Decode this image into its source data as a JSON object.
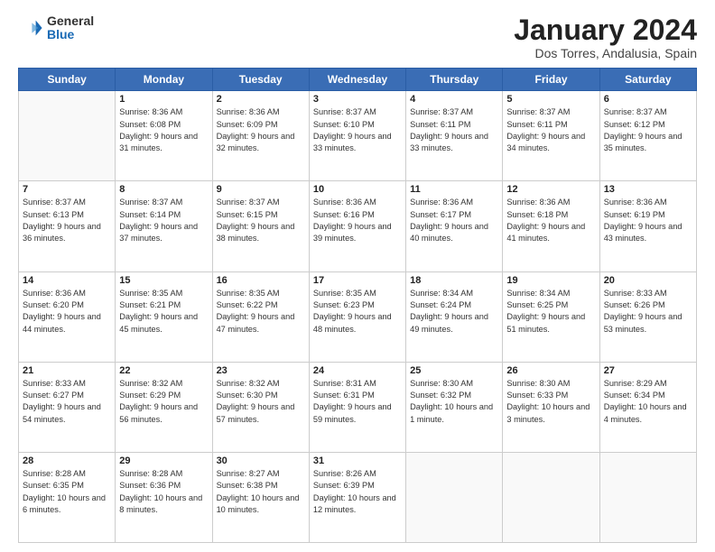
{
  "header": {
    "logo_general": "General",
    "logo_blue": "Blue",
    "month_title": "January 2024",
    "subtitle": "Dos Torres, Andalusia, Spain"
  },
  "weekdays": [
    "Sunday",
    "Monday",
    "Tuesday",
    "Wednesday",
    "Thursday",
    "Friday",
    "Saturday"
  ],
  "weeks": [
    [
      {
        "day": "",
        "empty": true
      },
      {
        "day": "1",
        "sunrise": "8:36 AM",
        "sunset": "6:08 PM",
        "daylight": "9 hours and 31 minutes."
      },
      {
        "day": "2",
        "sunrise": "8:36 AM",
        "sunset": "6:09 PM",
        "daylight": "9 hours and 32 minutes."
      },
      {
        "day": "3",
        "sunrise": "8:37 AM",
        "sunset": "6:10 PM",
        "daylight": "9 hours and 33 minutes."
      },
      {
        "day": "4",
        "sunrise": "8:37 AM",
        "sunset": "6:11 PM",
        "daylight": "9 hours and 33 minutes."
      },
      {
        "day": "5",
        "sunrise": "8:37 AM",
        "sunset": "6:11 PM",
        "daylight": "9 hours and 34 minutes."
      },
      {
        "day": "6",
        "sunrise": "8:37 AM",
        "sunset": "6:12 PM",
        "daylight": "9 hours and 35 minutes."
      }
    ],
    [
      {
        "day": "7",
        "sunrise": "8:37 AM",
        "sunset": "6:13 PM",
        "daylight": "9 hours and 36 minutes."
      },
      {
        "day": "8",
        "sunrise": "8:37 AM",
        "sunset": "6:14 PM",
        "daylight": "9 hours and 37 minutes."
      },
      {
        "day": "9",
        "sunrise": "8:37 AM",
        "sunset": "6:15 PM",
        "daylight": "9 hours and 38 minutes."
      },
      {
        "day": "10",
        "sunrise": "8:36 AM",
        "sunset": "6:16 PM",
        "daylight": "9 hours and 39 minutes."
      },
      {
        "day": "11",
        "sunrise": "8:36 AM",
        "sunset": "6:17 PM",
        "daylight": "9 hours and 40 minutes."
      },
      {
        "day": "12",
        "sunrise": "8:36 AM",
        "sunset": "6:18 PM",
        "daylight": "9 hours and 41 minutes."
      },
      {
        "day": "13",
        "sunrise": "8:36 AM",
        "sunset": "6:19 PM",
        "daylight": "9 hours and 43 minutes."
      }
    ],
    [
      {
        "day": "14",
        "sunrise": "8:36 AM",
        "sunset": "6:20 PM",
        "daylight": "9 hours and 44 minutes."
      },
      {
        "day": "15",
        "sunrise": "8:35 AM",
        "sunset": "6:21 PM",
        "daylight": "9 hours and 45 minutes."
      },
      {
        "day": "16",
        "sunrise": "8:35 AM",
        "sunset": "6:22 PM",
        "daylight": "9 hours and 47 minutes."
      },
      {
        "day": "17",
        "sunrise": "8:35 AM",
        "sunset": "6:23 PM",
        "daylight": "9 hours and 48 minutes."
      },
      {
        "day": "18",
        "sunrise": "8:34 AM",
        "sunset": "6:24 PM",
        "daylight": "9 hours and 49 minutes."
      },
      {
        "day": "19",
        "sunrise": "8:34 AM",
        "sunset": "6:25 PM",
        "daylight": "9 hours and 51 minutes."
      },
      {
        "day": "20",
        "sunrise": "8:33 AM",
        "sunset": "6:26 PM",
        "daylight": "9 hours and 53 minutes."
      }
    ],
    [
      {
        "day": "21",
        "sunrise": "8:33 AM",
        "sunset": "6:27 PM",
        "daylight": "9 hours and 54 minutes."
      },
      {
        "day": "22",
        "sunrise": "8:32 AM",
        "sunset": "6:29 PM",
        "daylight": "9 hours and 56 minutes."
      },
      {
        "day": "23",
        "sunrise": "8:32 AM",
        "sunset": "6:30 PM",
        "daylight": "9 hours and 57 minutes."
      },
      {
        "day": "24",
        "sunrise": "8:31 AM",
        "sunset": "6:31 PM",
        "daylight": "9 hours and 59 minutes."
      },
      {
        "day": "25",
        "sunrise": "8:30 AM",
        "sunset": "6:32 PM",
        "daylight": "10 hours and 1 minute."
      },
      {
        "day": "26",
        "sunrise": "8:30 AM",
        "sunset": "6:33 PM",
        "daylight": "10 hours and 3 minutes."
      },
      {
        "day": "27",
        "sunrise": "8:29 AM",
        "sunset": "6:34 PM",
        "daylight": "10 hours and 4 minutes."
      }
    ],
    [
      {
        "day": "28",
        "sunrise": "8:28 AM",
        "sunset": "6:35 PM",
        "daylight": "10 hours and 6 minutes."
      },
      {
        "day": "29",
        "sunrise": "8:28 AM",
        "sunset": "6:36 PM",
        "daylight": "10 hours and 8 minutes."
      },
      {
        "day": "30",
        "sunrise": "8:27 AM",
        "sunset": "6:38 PM",
        "daylight": "10 hours and 10 minutes."
      },
      {
        "day": "31",
        "sunrise": "8:26 AM",
        "sunset": "6:39 PM",
        "daylight": "10 hours and 12 minutes."
      },
      {
        "day": "",
        "empty": true
      },
      {
        "day": "",
        "empty": true
      },
      {
        "day": "",
        "empty": true
      }
    ]
  ]
}
